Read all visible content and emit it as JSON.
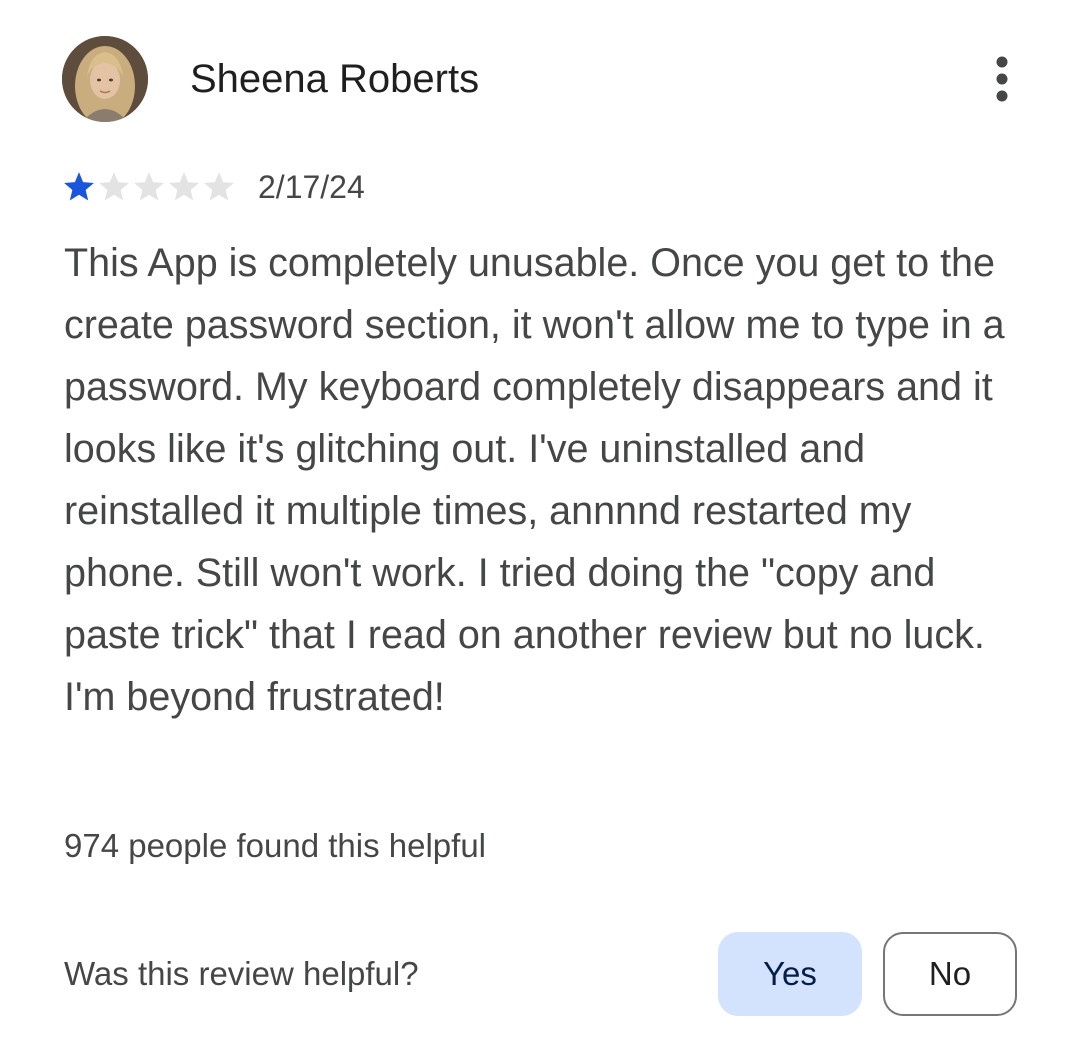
{
  "review": {
    "author_name": "Sheena Roberts",
    "rating": 1,
    "rating_max": 5,
    "date": "2/17/24",
    "text": "This App is completely unusable. Once you get to the create password section, it won't allow me to type in a password. My keyboard completely disappears and it looks like it's glitching out. I've uninstalled and reinstalled it multiple times, annnnd restarted my phone. Still won't work. I tried doing the \"copy and paste trick\" that I read on another review but no luck. I'm beyond frustrated!",
    "helpful_count_text": "974 people found this helpful"
  },
  "feedback": {
    "question": "Was this review helpful?",
    "yes_label": "Yes",
    "no_label": "No"
  },
  "icons": {
    "menu": "more-vertical-icon",
    "avatar": "user-photo-avatar",
    "star": "star-icon"
  },
  "colors": {
    "star_filled": "#1a56db",
    "star_empty": "#e3e3e3",
    "yes_button_bg": "#d3e3fd",
    "text": "#444746"
  }
}
